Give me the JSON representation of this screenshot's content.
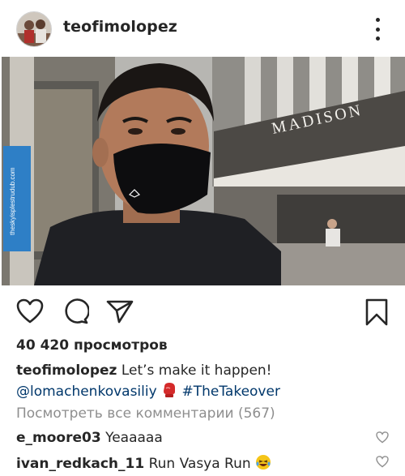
{
  "post": {
    "username": "teofimolopez",
    "views": "40 420 просмотров",
    "caption_user": "teofimolopez",
    "caption_text": "Let’s make it happen!",
    "mention": "@lomachenkovasiliy",
    "hashtag": "#TheTakeover",
    "view_comments": "Посмотреть все комментарии (567)"
  },
  "photo": {
    "building_sign": "MADISON",
    "banner_text": "theskyisplestrudub.com"
  },
  "comments": [
    {
      "user": "e_moore03",
      "text": "Yeaaaaa"
    },
    {
      "user": "ivan_redkach_11",
      "text": "Run Vasya Run"
    }
  ],
  "icons": {
    "more": "more-vertical-icon",
    "user_tag": "user-tag-icon",
    "like": "heart-icon",
    "comment": "comment-icon",
    "share": "send-icon",
    "save": "bookmark-icon",
    "boxing_glove": "boxing-glove-emoji",
    "laughing": "laughing-emoji"
  },
  "colors": {
    "link": "#00376b",
    "muted": "#8e8e8e",
    "text": "#262626"
  }
}
